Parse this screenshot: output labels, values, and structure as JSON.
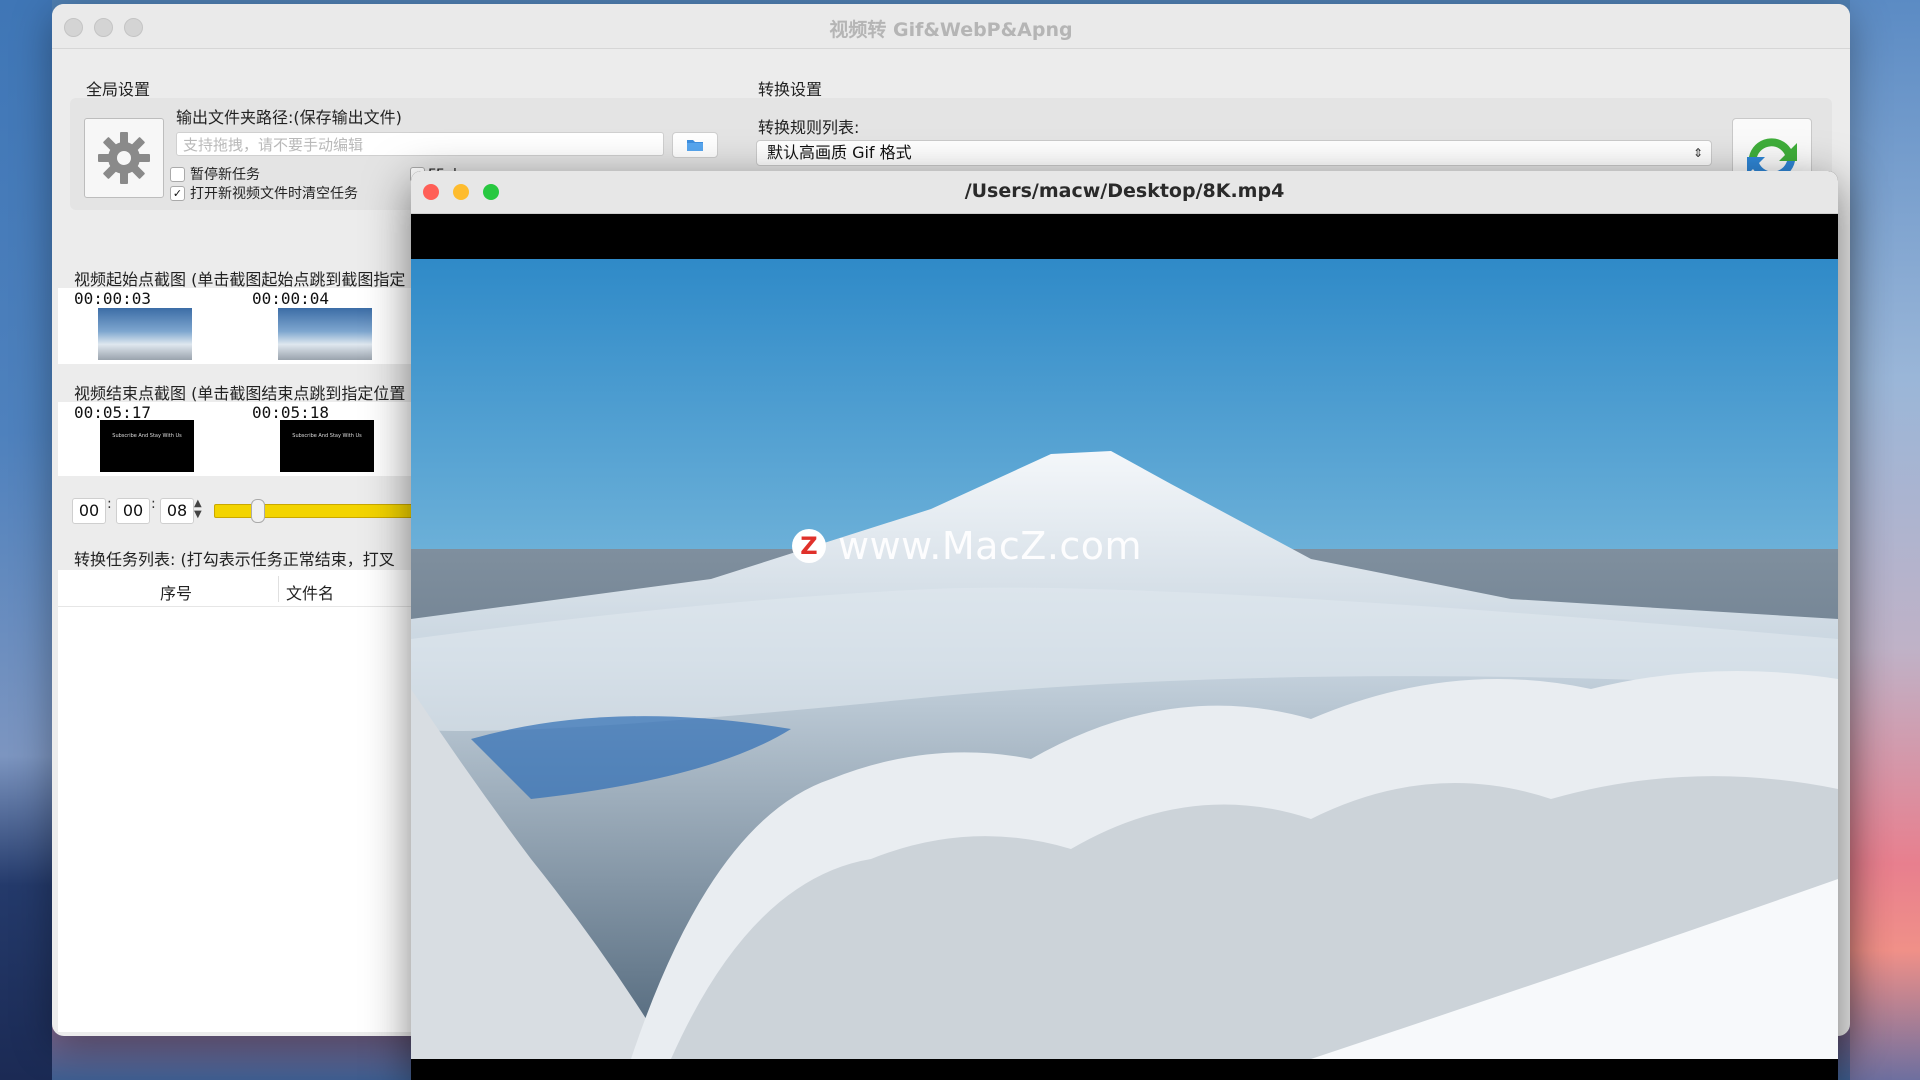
{
  "app": {
    "title": "视频转 Gif&WebP&Apng"
  },
  "global_settings": {
    "group_title": "全局设置",
    "output_path_label": "输出文件夹路径:(保存输出文件)",
    "output_path_placeholder": "支持拖拽，请不要手动编辑",
    "pause_new_task_label": "暂停新任务",
    "pause_new_task_checked": false,
    "clear_on_open_label": "打开新视频文件时清空任务",
    "clear_on_open_checked": true,
    "partial_label": "FFplay 静音"
  },
  "conversion_settings": {
    "group_title": "转换设置",
    "rules_label": "转换规则列表:",
    "selected_rule": "默认高画质 Gif 格式"
  },
  "start_frames": {
    "label": "视频起始点截图 (单击截图起始点跳到截图指定",
    "frames": [
      {
        "time": "00:00:03",
        "kind": "mountain"
      },
      {
        "time": "00:00:04",
        "kind": "mountain"
      }
    ]
  },
  "end_frames": {
    "label": "视频结束点截图 (单击截图结束点跳到指定位置",
    "frames": [
      {
        "time": "00:05:17",
        "kind": "black",
        "text": "Subscribe And Stay With Us"
      },
      {
        "time": "00:05:18",
        "kind": "black",
        "text": "Subscribe And Stay With Us"
      }
    ]
  },
  "duration": {
    "hours": "00",
    "minutes": "00",
    "seconds": "08",
    "slider_position": 0.05
  },
  "task_list": {
    "label": "转换任务列表: (打勾表示任务正常结束，打叉",
    "columns": [
      "序号",
      "文件名"
    ]
  },
  "video_window": {
    "title": "/Users/macw/Desktop/8K.mp4",
    "watermark_letter": "Z",
    "watermark_text": "www.MacZ.com",
    "dot_colors": [
      "#ff5f57",
      "#febc2e",
      "#28c840"
    ]
  }
}
